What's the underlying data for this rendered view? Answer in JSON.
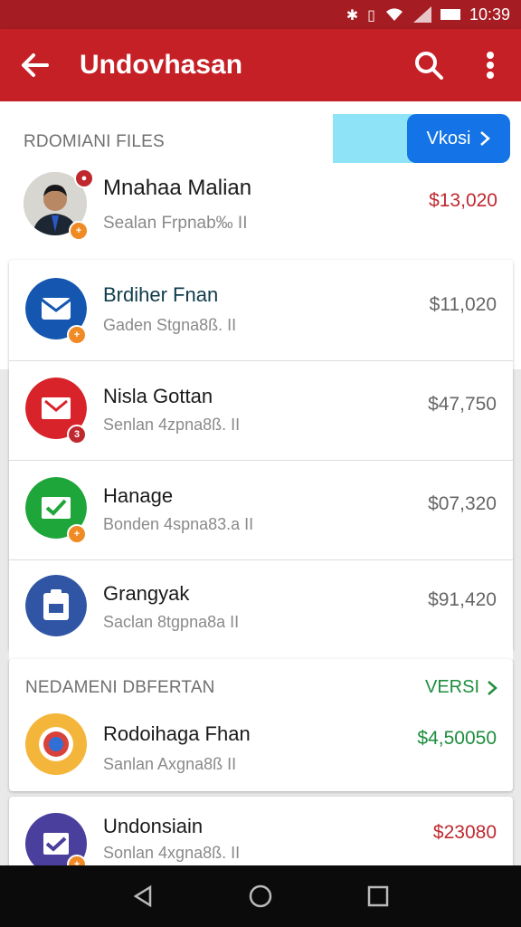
{
  "status_bar": {
    "time": "10:39"
  },
  "app_bar": {
    "title": "Undovhasan"
  },
  "section1": {
    "title": "RDOMIANI FILES",
    "button_label": "Vkosi",
    "featured": {
      "name": "Mnahaa Malian",
      "subtitle": "Sealan Frpnab‰ II",
      "amount": "$13,020",
      "amount_color": "#c0282f"
    },
    "items": [
      {
        "name": "Brdiher Fnan",
        "subtitle": "Gaden Stgna8ß. II",
        "amount": "$11,020",
        "icon_color": "#1557b0",
        "badge_color": "#f08a24"
      },
      {
        "name": "Nisla Gottan",
        "subtitle": "Senlan 4zpna8ß. II",
        "amount": "$47,750",
        "icon_color": "#d9232a",
        "badge_color": "#c0282f"
      },
      {
        "name": "Hanage",
        "subtitle": "Bonden 4spna83.a II",
        "amount": "$07,320",
        "icon_color": "#1fa63a",
        "badge_color": "#f08a24"
      },
      {
        "name": "Grangyak",
        "subtitle": "Saclan 8tgpna8a II",
        "amount": "$91,420",
        "icon_color": "#2f55a4",
        "badge_color": ""
      }
    ]
  },
  "section2": {
    "title": "NEDAMENI DBFERTAN",
    "link_label": "VERSI",
    "items": [
      {
        "name": "Rodoihaga Fhan",
        "subtitle": "Sanlan Axgna8ß II",
        "amount": "$4,50050",
        "amount_color": "#1e8e3e",
        "icon_color": "#f4b63a"
      },
      {
        "name": "Undonsiain",
        "subtitle": "Sonlan 4xgna8ß. II",
        "amount": "$23080",
        "amount_color": "#c0282f",
        "icon_color": "#4a3f9c"
      }
    ]
  }
}
